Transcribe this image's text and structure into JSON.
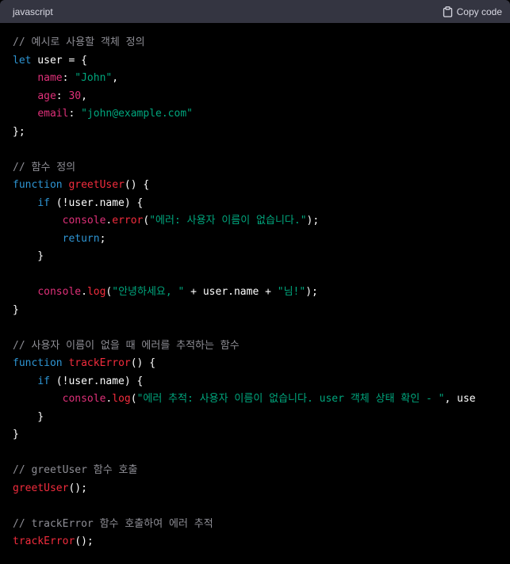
{
  "header": {
    "language": "javascript",
    "copy_label": "Copy code",
    "copy_icon": "clipboard-icon"
  },
  "colors": {
    "header_bg": "#343541",
    "code_bg": "#000000",
    "comment": "#8e8e95",
    "keyword": "#2e95d3",
    "function": "#f22c3d",
    "property": "#df3079",
    "string": "#00a67d",
    "plain": "#ffffff"
  },
  "code_lines": [
    [
      {
        "t": "// 예시로 사용할 객체 정의",
        "c": "comment"
      }
    ],
    [
      {
        "t": "let",
        "c": "kw"
      },
      {
        "t": " user = {",
        "c": "plain"
      }
    ],
    [
      {
        "t": "    ",
        "c": "plain"
      },
      {
        "t": "name",
        "c": "prop"
      },
      {
        "t": ": ",
        "c": "plain"
      },
      {
        "t": "\"John\"",
        "c": "str"
      },
      {
        "t": ",",
        "c": "plain"
      }
    ],
    [
      {
        "t": "    ",
        "c": "plain"
      },
      {
        "t": "age",
        "c": "prop"
      },
      {
        "t": ": ",
        "c": "plain"
      },
      {
        "t": "30",
        "c": "num"
      },
      {
        "t": ",",
        "c": "plain"
      }
    ],
    [
      {
        "t": "    ",
        "c": "plain"
      },
      {
        "t": "email",
        "c": "prop"
      },
      {
        "t": ": ",
        "c": "plain"
      },
      {
        "t": "\"john@example.com\"",
        "c": "str"
      }
    ],
    [
      {
        "t": "};",
        "c": "plain"
      }
    ],
    [],
    [
      {
        "t": "// 함수 정의",
        "c": "comment"
      }
    ],
    [
      {
        "t": "function",
        "c": "kw"
      },
      {
        "t": " ",
        "c": "plain"
      },
      {
        "t": "greetUser",
        "c": "fn"
      },
      {
        "t": "() {",
        "c": "plain"
      }
    ],
    [
      {
        "t": "    ",
        "c": "plain"
      },
      {
        "t": "if",
        "c": "kw"
      },
      {
        "t": " (!user.name) {",
        "c": "plain"
      }
    ],
    [
      {
        "t": "        ",
        "c": "plain"
      },
      {
        "t": "console",
        "c": "prop"
      },
      {
        "t": ".",
        "c": "plain"
      },
      {
        "t": "error",
        "c": "fn"
      },
      {
        "t": "(",
        "c": "plain"
      },
      {
        "t": "\"에러: 사용자 이름이 없습니다.\"",
        "c": "str"
      },
      {
        "t": ");",
        "c": "plain"
      }
    ],
    [
      {
        "t": "        ",
        "c": "plain"
      },
      {
        "t": "return",
        "c": "kw"
      },
      {
        "t": ";",
        "c": "plain"
      }
    ],
    [
      {
        "t": "    }",
        "c": "plain"
      }
    ],
    [],
    [
      {
        "t": "    ",
        "c": "plain"
      },
      {
        "t": "console",
        "c": "prop"
      },
      {
        "t": ".",
        "c": "plain"
      },
      {
        "t": "log",
        "c": "fn"
      },
      {
        "t": "(",
        "c": "plain"
      },
      {
        "t": "\"안녕하세요, \"",
        "c": "str"
      },
      {
        "t": " + user.name + ",
        "c": "plain"
      },
      {
        "t": "\"님!\"",
        "c": "str"
      },
      {
        "t": ");",
        "c": "plain"
      }
    ],
    [
      {
        "t": "}",
        "c": "plain"
      }
    ],
    [],
    [
      {
        "t": "// 사용자 이름이 없을 때 에러를 추적하는 함수",
        "c": "comment"
      }
    ],
    [
      {
        "t": "function",
        "c": "kw"
      },
      {
        "t": " ",
        "c": "plain"
      },
      {
        "t": "trackError",
        "c": "fn"
      },
      {
        "t": "() {",
        "c": "plain"
      }
    ],
    [
      {
        "t": "    ",
        "c": "plain"
      },
      {
        "t": "if",
        "c": "kw"
      },
      {
        "t": " (!user.name) {",
        "c": "plain"
      }
    ],
    [
      {
        "t": "        ",
        "c": "plain"
      },
      {
        "t": "console",
        "c": "prop"
      },
      {
        "t": ".",
        "c": "plain"
      },
      {
        "t": "log",
        "c": "fn"
      },
      {
        "t": "(",
        "c": "plain"
      },
      {
        "t": "\"에러 추적: 사용자 이름이 없습니다. user 객체 상태 확인 - \"",
        "c": "str"
      },
      {
        "t": ", use",
        "c": "plain"
      }
    ],
    [
      {
        "t": "    }",
        "c": "plain"
      }
    ],
    [
      {
        "t": "}",
        "c": "plain"
      }
    ],
    [],
    [
      {
        "t": "// greetUser 함수 호출",
        "c": "comment"
      }
    ],
    [
      {
        "t": "greetUser",
        "c": "fn"
      },
      {
        "t": "();",
        "c": "plain"
      }
    ],
    [],
    [
      {
        "t": "// trackError 함수 호출하여 에러 추적",
        "c": "comment"
      }
    ],
    [
      {
        "t": "trackError",
        "c": "fn"
      },
      {
        "t": "();",
        "c": "plain"
      }
    ]
  ]
}
